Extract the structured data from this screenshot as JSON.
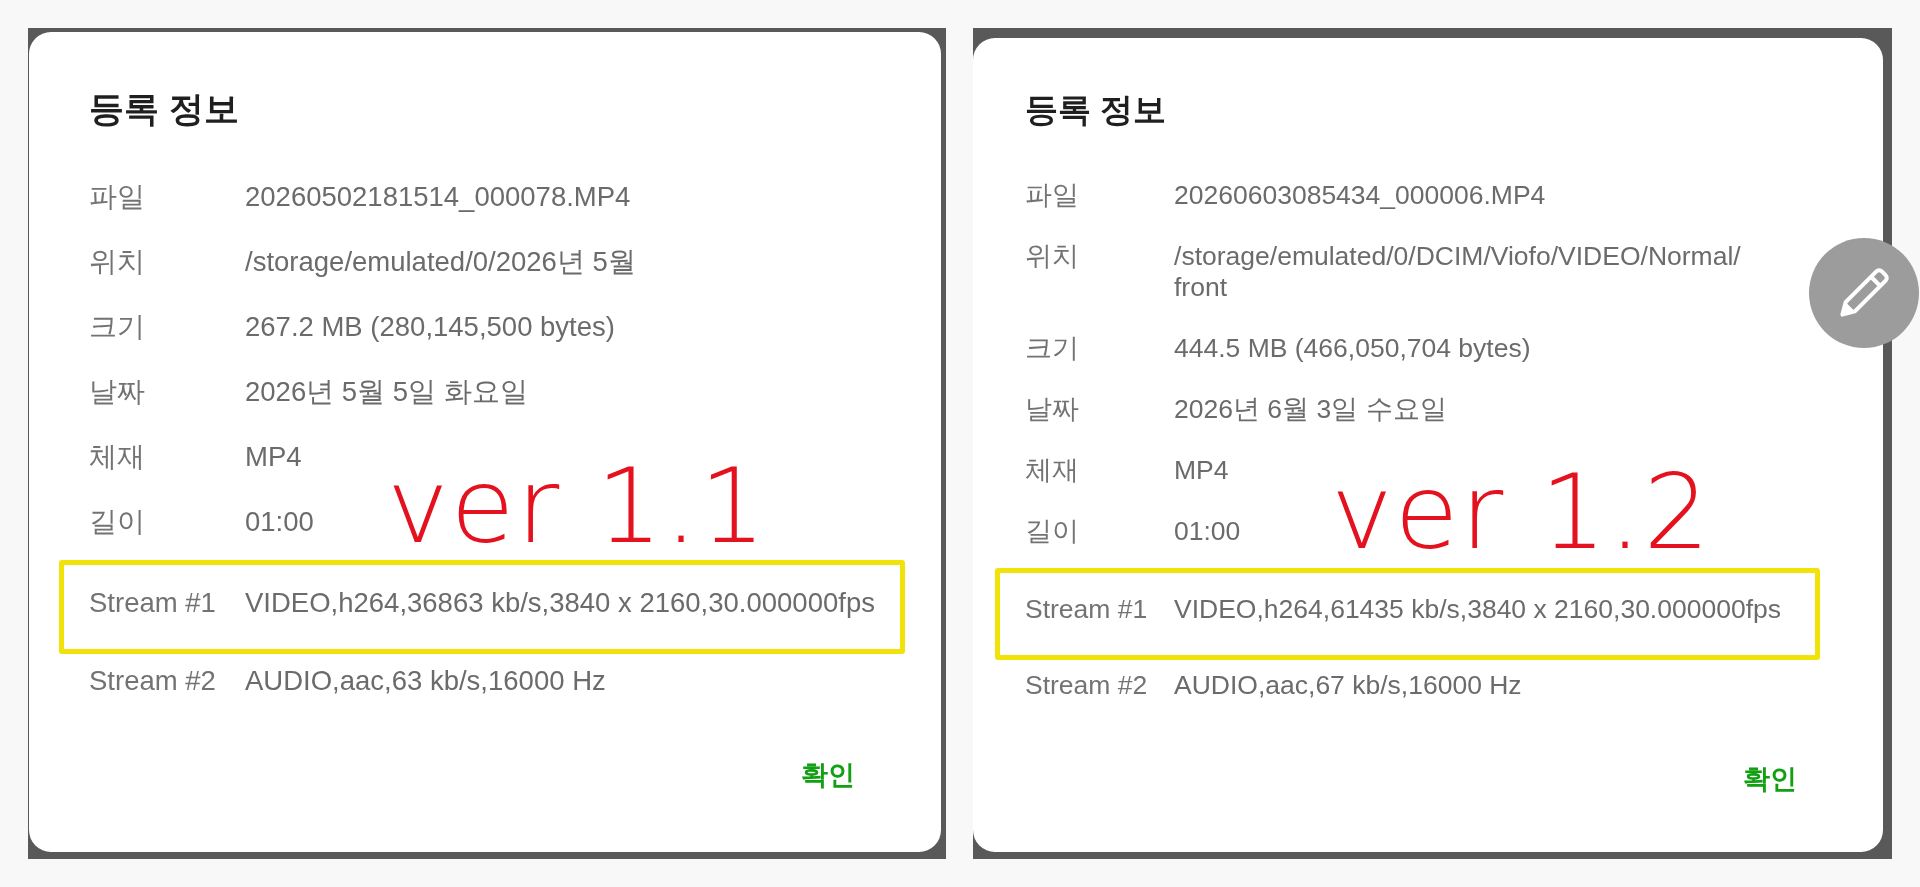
{
  "panels": [
    {
      "dialog": {
        "title": "등록 정보",
        "properties": [
          {
            "label": "파일",
            "value": "20260502181514_000078.MP4"
          },
          {
            "label": "위치",
            "value": "/storage/emulated/0/2026년 5월"
          },
          {
            "label": "크기",
            "value": "267.2 MB (280,145,500 bytes)"
          },
          {
            "label": "날짜",
            "value": "2026년 5월 5일 화요일"
          },
          {
            "label": "체재",
            "value": "MP4"
          },
          {
            "label": "길이",
            "value": "01:00"
          }
        ],
        "streams": [
          {
            "label": "Stream #1",
            "value": "VIDEO,h264,36863 kb/s,3840 x 2160,30.000000fps",
            "highlighted": true
          },
          {
            "label": "Stream #2",
            "value": "AUDIO,aac,63 kb/s,16000 Hz",
            "highlighted": false
          }
        ],
        "confirm_button": "확인"
      },
      "handwritten_note": "ver 1.1",
      "edit_button": false
    },
    {
      "dialog": {
        "title": "등록 정보",
        "properties": [
          {
            "label": "파일",
            "value": "20260603085434_000006.MP4"
          },
          {
            "label": "위치",
            "value": "/storage/emulated/0/DCIM/Viofo/VIDEO/Normal/front"
          },
          {
            "label": "크기",
            "value": "444.5 MB (466,050,704 bytes)"
          },
          {
            "label": "날짜",
            "value": "2026년 6월 3일 수요일"
          },
          {
            "label": "체재",
            "value": "MP4"
          },
          {
            "label": "길이",
            "value": "01:00"
          }
        ],
        "streams": [
          {
            "label": "Stream #1",
            "value": "VIDEO,h264,61435 kb/s,3840 x 2160,30.000000fps",
            "highlighted": true
          },
          {
            "label": "Stream #2",
            "value": "AUDIO,aac,67 kb/s,16000 Hz",
            "highlighted": false
          }
        ],
        "confirm_button": "확인"
      },
      "handwritten_note": "ver 1.2",
      "edit_button": true
    }
  ]
}
